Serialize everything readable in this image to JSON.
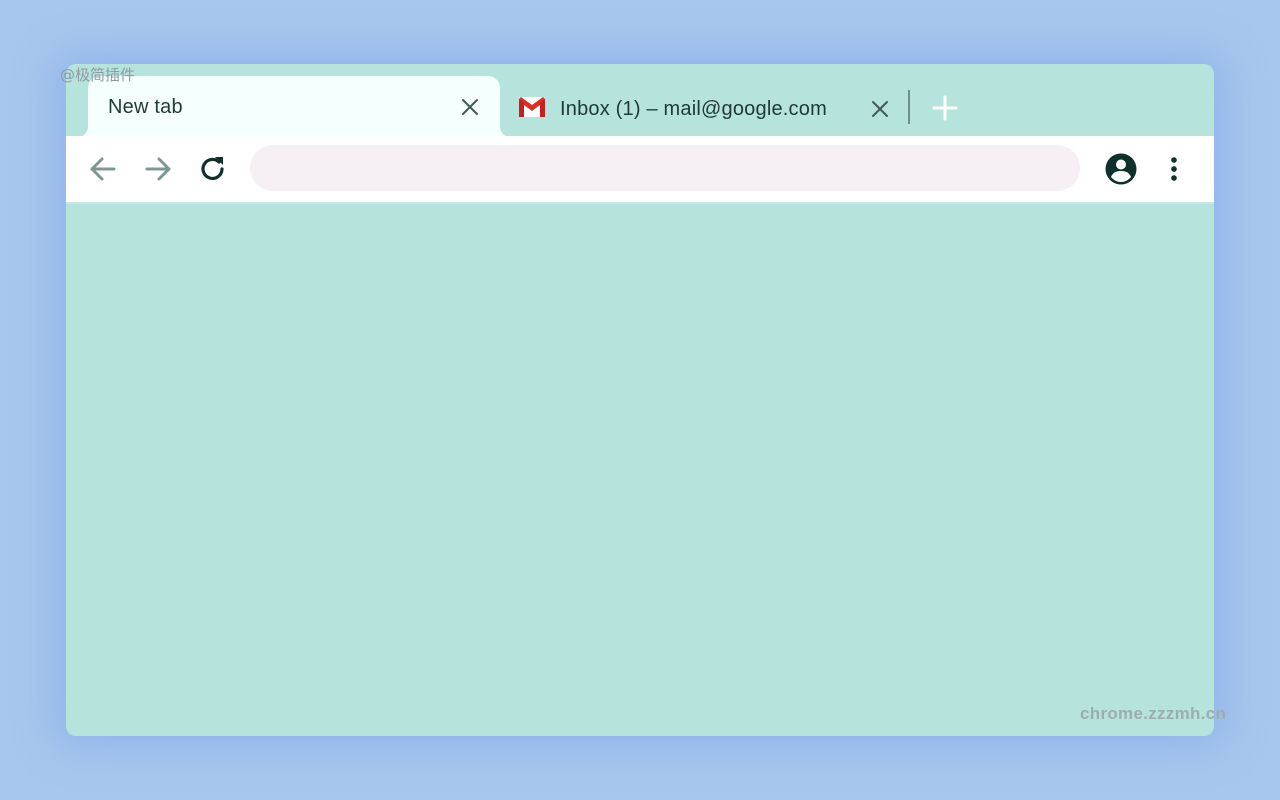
{
  "watermarks": {
    "top_left": "@极简插件",
    "bottom_right": "chrome.zzzmh.cn"
  },
  "tabs": [
    {
      "title": "New tab",
      "active": true,
      "icon": "none"
    },
    {
      "title": "Inbox (1) – mail@google.com",
      "active": false,
      "icon": "gmail-icon"
    }
  ],
  "toolbar": {
    "back_icon": "arrow-left-icon",
    "forward_icon": "arrow-right-icon",
    "reload_icon": "reload-icon",
    "omnibox_value": "",
    "profile_icon": "account-circle-icon",
    "menu_icon": "more-vert-icon"
  },
  "colors": {
    "desktop_background": "#a8c7ee",
    "window_frame": "#b6e3dc",
    "active_tab": "#f5fffd",
    "omnibox": "#f6eff3",
    "icon_dark": "#0f302b",
    "icon_disabled": "#7d9794",
    "gmail_red": "#d93025"
  }
}
